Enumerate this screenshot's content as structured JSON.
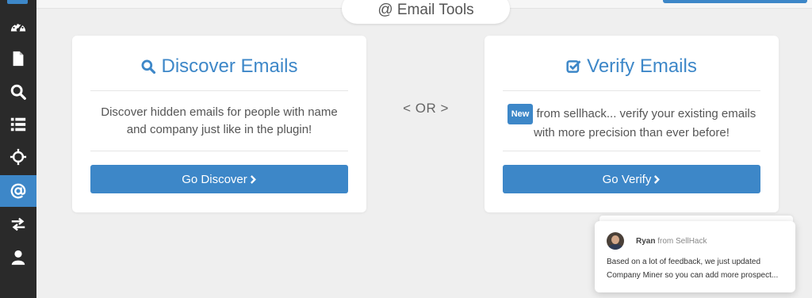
{
  "header": {
    "title": "@ Email Tools"
  },
  "sidebar": {
    "items": [
      {
        "icon": "dashboard-icon",
        "active": false
      },
      {
        "icon": "document-icon",
        "active": false
      },
      {
        "icon": "search-icon",
        "active": false
      },
      {
        "icon": "list-icon",
        "active": false
      },
      {
        "icon": "crosshair-icon",
        "active": false
      },
      {
        "icon": "at-sign-icon",
        "active": true
      },
      {
        "icon": "exchange-icon",
        "active": false
      },
      {
        "icon": "user-icon",
        "active": false
      }
    ]
  },
  "discover": {
    "title": "Discover Emails",
    "icon": "search-icon",
    "description": "Discover hidden emails for people with name and company just like in the plugin!",
    "button": "Go Discover"
  },
  "separator": "< OR >",
  "verify": {
    "title": "Verify Emails",
    "icon": "checkbox-icon",
    "badge": "New",
    "description": "from sellhack... verify your existing emails with more precision than ever before!",
    "button": "Go Verify"
  },
  "chat": {
    "sender": "Ryan",
    "sender_org": "from SellHack",
    "message": "Based on a lot of feedback, we just updated Company Miner so you can add more prospect..."
  },
  "colors": {
    "accent": "#3d87c8",
    "sidebar": "#2a2a2a",
    "background": "#efefef"
  }
}
